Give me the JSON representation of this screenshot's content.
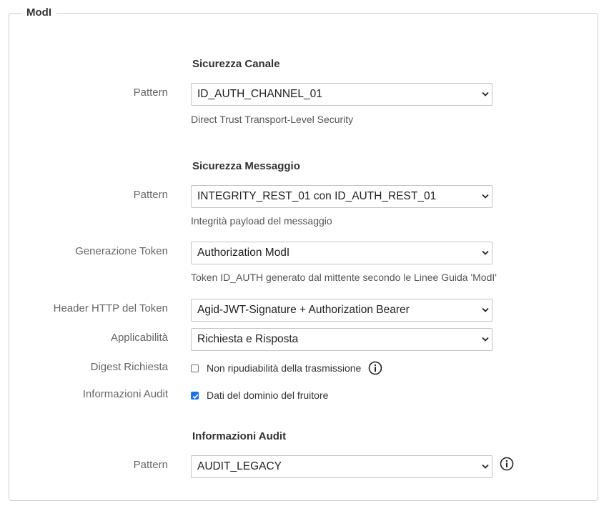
{
  "fieldset": {
    "legend": "ModI"
  },
  "channel_security": {
    "title": "Sicurezza Canale",
    "pattern_label": "Pattern",
    "pattern_value": "ID_AUTH_CHANNEL_01",
    "pattern_hint": "Direct Trust Transport-Level Security"
  },
  "message_security": {
    "title": "Sicurezza Messaggio",
    "pattern_label": "Pattern",
    "pattern_value": "INTEGRITY_REST_01 con ID_AUTH_REST_01",
    "pattern_hint": "Integrità payload del messaggio",
    "token_gen_label": "Generazione Token",
    "token_gen_value": "Authorization ModI",
    "token_gen_hint": "Token ID_AUTH generato dal mittente secondo le Linee Guida 'ModI'",
    "header_label": "Header HTTP del Token",
    "header_value": "Agid-JWT-Signature + Authorization Bearer",
    "applicability_label": "Applicabilità",
    "applicability_value": "Richiesta e Risposta",
    "digest_label": "Digest Richiesta",
    "digest_checkbox_label": "Non ripudiabilità della trasmissione",
    "digest_checked": false,
    "audit_info_label": "Informazioni Audit",
    "audit_info_checkbox_label": "Dati del dominio del fruitore",
    "audit_info_checked": true
  },
  "audit": {
    "title": "Informazioni Audit",
    "pattern_label": "Pattern",
    "pattern_value": "AUDIT_LEGACY"
  },
  "icons": {
    "info": "info-circle-icon",
    "chevron": "chevron-down-icon"
  },
  "colors": {
    "checkbox_checked": "#1a73e8",
    "border": "#c4c4c4"
  }
}
